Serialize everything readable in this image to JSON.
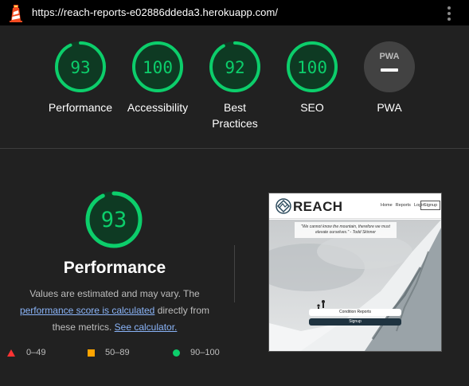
{
  "topbar": {
    "url": "https://reach-reports-e02886ddeda3.herokuapp.com/"
  },
  "gauges": [
    {
      "score": "93",
      "label": "Performance",
      "fraction": 0.93
    },
    {
      "score": "100",
      "label": "Accessibility",
      "fraction": 1.0
    },
    {
      "score": "92",
      "label": "Best Practices",
      "fraction": 0.92
    },
    {
      "score": "100",
      "label": "SEO",
      "fraction": 1.0
    },
    {
      "badge_text": "PWA",
      "label": "PWA"
    }
  ],
  "performance": {
    "score": "93",
    "fraction": 0.93,
    "title": "Performance",
    "desc_part1": "Values are estimated and may vary. The ",
    "desc_link1": "performance score is calculated",
    "desc_part2": " directly from these metrics. ",
    "desc_link2": "See calculator."
  },
  "legend": [
    {
      "range": "0–49",
      "shape": "triangle",
      "color": "#ff3333"
    },
    {
      "range": "50–89",
      "shape": "square",
      "color": "#ffa400"
    },
    {
      "range": "90–100",
      "shape": "circle",
      "color": "#0cce6b"
    }
  ],
  "screenshot": {
    "brand": "REACH",
    "nav_links": [
      "Home",
      "Reports",
      "Login"
    ],
    "nav_signup": "Signup",
    "quote": "\"We cannot know the mountain, therefore we must elevate ourselves.\" - Todd Skinner",
    "button1": "Condition Reports",
    "button2": "Signup"
  },
  "colors": {
    "pass": "#0cce6b",
    "gauge_track": "#0e3a23",
    "background": "#212121"
  }
}
